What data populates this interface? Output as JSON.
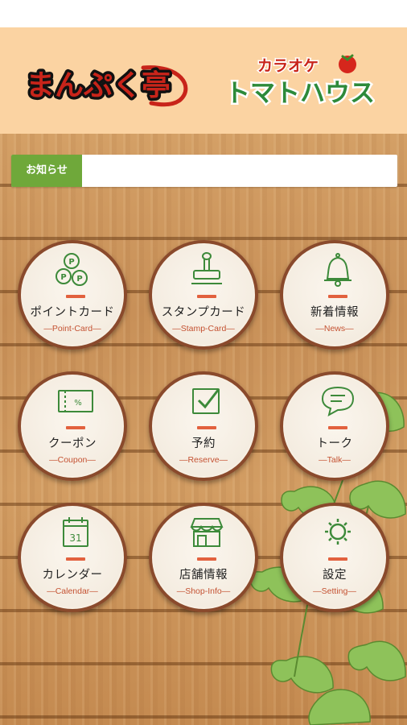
{
  "header": {
    "logo_left_text": "まんぷく亭",
    "logo_right_top": "カラオケ",
    "logo_right_main": "トマトハウス"
  },
  "news": {
    "label": "お知らせ",
    "text": ""
  },
  "menu": [
    {
      "label": "ポイントカード",
      "sub": "Point-Card",
      "icon": "point-card-icon"
    },
    {
      "label": "スタンプカード",
      "sub": "Stamp-Card",
      "icon": "stamp-icon"
    },
    {
      "label": "新着情報",
      "sub": "News",
      "icon": "bell-icon"
    },
    {
      "label": "クーポン",
      "sub": "Coupon",
      "icon": "coupon-icon"
    },
    {
      "label": "予約",
      "sub": "Reserve",
      "icon": "checkbox-icon"
    },
    {
      "label": "トーク",
      "sub": "Talk",
      "icon": "chat-bubble-icon"
    },
    {
      "label": "カレンダー",
      "sub": "Calendar",
      "icon": "calendar-icon"
    },
    {
      "label": "店舗情報",
      "sub": "Shop-Info",
      "icon": "shop-icon"
    },
    {
      "label": "設定",
      "sub": "Setting",
      "icon": "gear-icon"
    }
  ],
  "colors": {
    "header_bg": "#fbd3a2",
    "news_label_bg": "#6fa83a",
    "accent": "#e2613e",
    "button_border": "#8a4a2c"
  }
}
